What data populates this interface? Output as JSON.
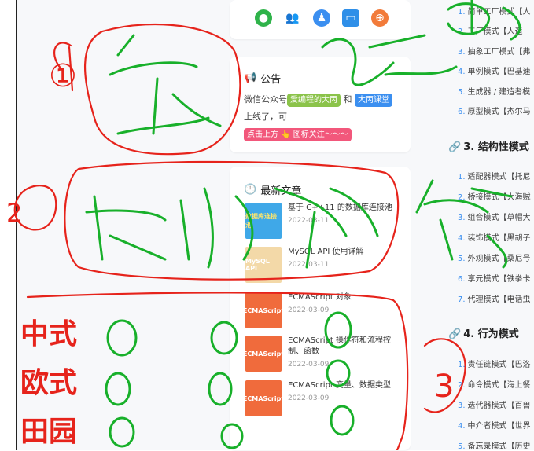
{
  "notice": {
    "title": "公告",
    "line1_prefix": "微信公众号",
    "tag1": "爱编程的大丙",
    "line1_mid": "和",
    "tag2": "大丙课堂",
    "line2": "上线了，可",
    "cta": "点击上方 👆 图标关注～～～"
  },
  "recent": {
    "title": "最新文章",
    "posts": [
      {
        "thumb": "数据库连接池",
        "title": "基于 C++11 的数据库连接池",
        "date": "2022-03-11"
      },
      {
        "thumb": "MySQL API",
        "title": "MySQL API 使用详解",
        "date": "2022-03-11"
      },
      {
        "thumb": "ECMAScript",
        "title": "ECMAScript 对象",
        "date": "2022-03-09"
      },
      {
        "thumb": "ECMAScript",
        "title": "ECMAScript 操作符和流程控制、函数",
        "date": "2022-03-09"
      },
      {
        "thumb": "ECMAScript",
        "title": "ECMAScript 变量、数据类型",
        "date": "2022-03-09"
      }
    ]
  },
  "toc": {
    "creational": [
      {
        "n": "1.",
        "t": "简单工厂模式【人"
      },
      {
        "n": "2.",
        "t": "工厂模式【人造"
      },
      {
        "n": "3.",
        "t": "抽象工厂模式【弗"
      },
      {
        "n": "4.",
        "t": "单例模式【巴基速"
      },
      {
        "n": "5.",
        "t": "生成器 / 建造者模"
      },
      {
        "n": "6.",
        "t": "原型模式【杰尔马"
      }
    ],
    "structural_title": "3. 结构性模式",
    "structural": [
      {
        "n": "1.",
        "t": "适配器模式【托尼"
      },
      {
        "n": "2.",
        "t": "桥接模式【大海贼"
      },
      {
        "n": "3.",
        "t": "组合模式【草帽大"
      },
      {
        "n": "4.",
        "t": "装饰模式【黑胡子"
      },
      {
        "n": "5.",
        "t": "外观模式【桑尼号"
      },
      {
        "n": "6.",
        "t": "享元模式【铁拳卡"
      },
      {
        "n": "7.",
        "t": "代理模式【电话虫"
      }
    ],
    "behavioral_title": "4. 行为模式",
    "behavioral": [
      {
        "n": "1.",
        "t": "责任链模式【巴洛"
      },
      {
        "n": "2.",
        "t": "命令模式【海上餐"
      },
      {
        "n": "3.",
        "t": "迭代器模式【百兽"
      },
      {
        "n": "4.",
        "t": "中介者模式【世界"
      },
      {
        "n": "5.",
        "t": "备忘录模式【历史"
      }
    ]
  },
  "annotations": {
    "style1": "中式",
    "style2": "欧式",
    "style3": "田园",
    "circle1": "①",
    "circle2": "2",
    "circle3": "3"
  },
  "colors": {
    "accent_blue": "#3b8ff0",
    "ink_green": "#18b02a",
    "ink_red": "#e6231b"
  }
}
